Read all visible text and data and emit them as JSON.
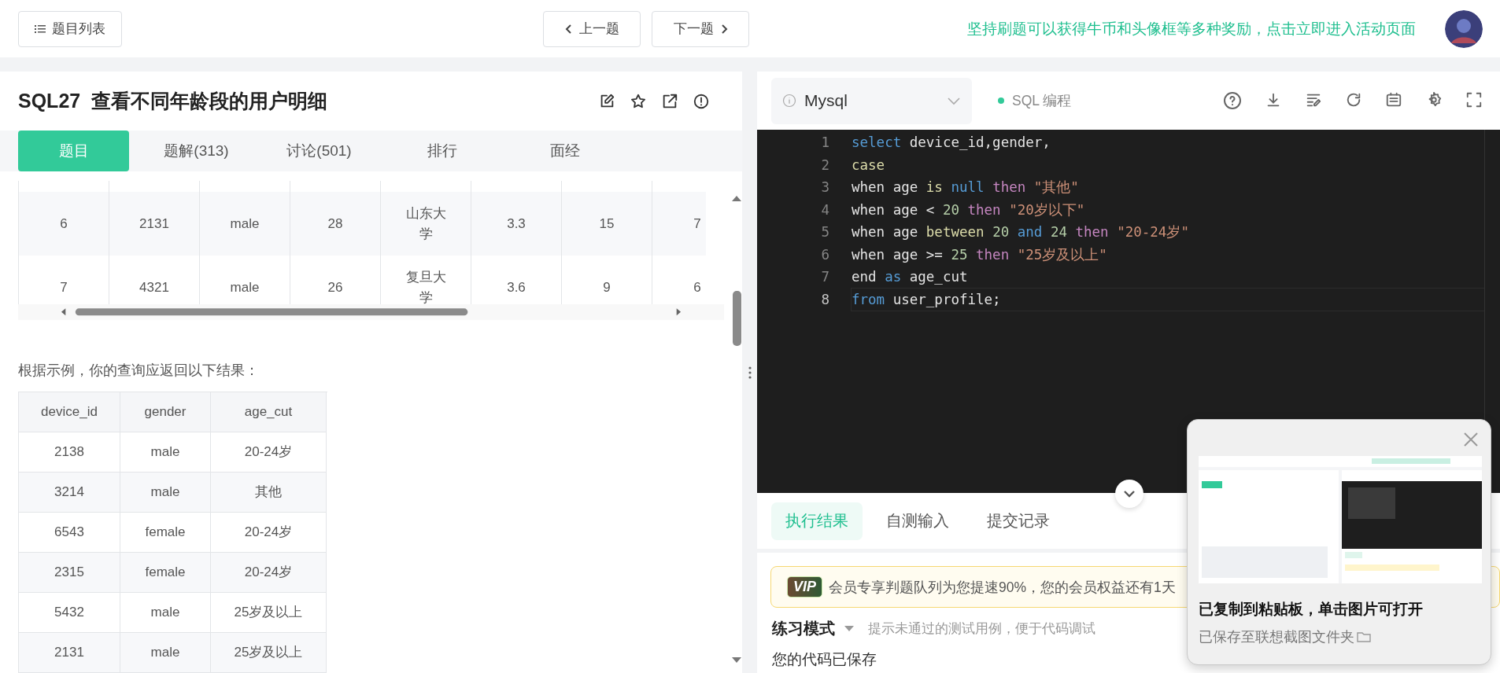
{
  "top_bar": {
    "list_button": "题目列表",
    "prev_button": "上一题",
    "next_button": "下一题",
    "promo_link": "坚持刷题可以获得牛币和头像框等多种奖励，点击立即进入活动页面"
  },
  "problem": {
    "id": "SQL27",
    "title": "查看不同年龄段的用户明细"
  },
  "tabs": [
    {
      "label": "题目",
      "selected": true
    },
    {
      "label": "题解(313)",
      "selected": false
    },
    {
      "label": "讨论(501)",
      "selected": false
    },
    {
      "label": "排行",
      "selected": false
    },
    {
      "label": "面经",
      "selected": false
    }
  ],
  "sample_table": {
    "rows": [
      [
        "6",
        "2131",
        "male",
        "28",
        "山东大学",
        "3.3",
        "15",
        "7"
      ],
      [
        "7",
        "4321",
        "male",
        "26",
        "复旦大学",
        "3.6",
        "9",
        "6"
      ]
    ]
  },
  "result_intro": "根据示例，你的查询应返回以下结果：",
  "result_table": {
    "columns": [
      "device_id",
      "gender",
      "age_cut"
    ],
    "rows": [
      [
        "2138",
        "male",
        "20-24岁"
      ],
      [
        "3214",
        "male",
        "其他"
      ],
      [
        "6543",
        "female",
        "20-24岁"
      ],
      [
        "2315",
        "female",
        "20-24岁"
      ],
      [
        "5432",
        "male",
        "25岁及以上"
      ],
      [
        "2131",
        "male",
        "25岁及以上"
      ]
    ]
  },
  "editor": {
    "language": "Mysql",
    "mode": "SQL 编程",
    "lines": [
      {
        "number": "1",
        "active": false,
        "tokens": [
          {
            "text": "select",
            "kind": "keyword"
          },
          {
            "text": " device_id,gender,",
            "kind": "plain"
          }
        ]
      },
      {
        "number": "2",
        "active": false,
        "tokens": [
          {
            "text": "case",
            "kind": "function"
          }
        ]
      },
      {
        "number": "3",
        "active": false,
        "tokens": [
          {
            "text": "when age",
            "kind": "plain"
          },
          {
            "text": " is",
            "kind": "function"
          },
          {
            "text": " null",
            "kind": "keyword"
          },
          {
            "text": " then",
            "kind": "control"
          },
          {
            "text": " \"其他\"",
            "kind": "string"
          }
        ]
      },
      {
        "number": "4",
        "active": false,
        "tokens": [
          {
            "text": "when age <",
            "kind": "plain"
          },
          {
            "text": " 20",
            "kind": "number"
          },
          {
            "text": " then",
            "kind": "control"
          },
          {
            "text": " \"20岁以下\"",
            "kind": "string"
          }
        ]
      },
      {
        "number": "5",
        "active": false,
        "tokens": [
          {
            "text": "when age",
            "kind": "plain"
          },
          {
            "text": " between",
            "kind": "function"
          },
          {
            "text": " 20",
            "kind": "number"
          },
          {
            "text": " and",
            "kind": "keyword"
          },
          {
            "text": " 24",
            "kind": "number"
          },
          {
            "text": " then",
            "kind": "control"
          },
          {
            "text": " \"20-24岁\"",
            "kind": "string"
          }
        ]
      },
      {
        "number": "6",
        "active": false,
        "tokens": [
          {
            "text": "when age >=",
            "kind": "plain"
          },
          {
            "text": " 25",
            "kind": "number"
          },
          {
            "text": " then",
            "kind": "control"
          },
          {
            "text": " \"25岁及以上\"",
            "kind": "string"
          }
        ]
      },
      {
        "number": "7",
        "active": false,
        "tokens": [
          {
            "text": "end",
            "kind": "plain"
          },
          {
            "text": " as",
            "kind": "keyword"
          },
          {
            "text": " age_cut",
            "kind": "plain"
          }
        ]
      },
      {
        "number": "8",
        "active": true,
        "tokens": [
          {
            "text": "from",
            "kind": "keyword"
          },
          {
            "text": " user_profile;",
            "kind": "plain"
          }
        ]
      }
    ]
  },
  "result_tabs": [
    {
      "label": "执行结果",
      "selected": true
    },
    {
      "label": "自测输入",
      "selected": false
    },
    {
      "label": "提交记录",
      "selected": false
    }
  ],
  "vip_banner": {
    "badge": "VIP",
    "text": "会员专享判题队列为您提速90%，您的会员权益还有1天"
  },
  "practice": {
    "mode": "练习模式",
    "hint": "提示未通过的测试用例，便于代码调试"
  },
  "status": "您的代码已保存",
  "toast": {
    "title": "已复制到粘贴板，单击图片可打开",
    "subtitle": "已保存至联想截图文件夹"
  }
}
